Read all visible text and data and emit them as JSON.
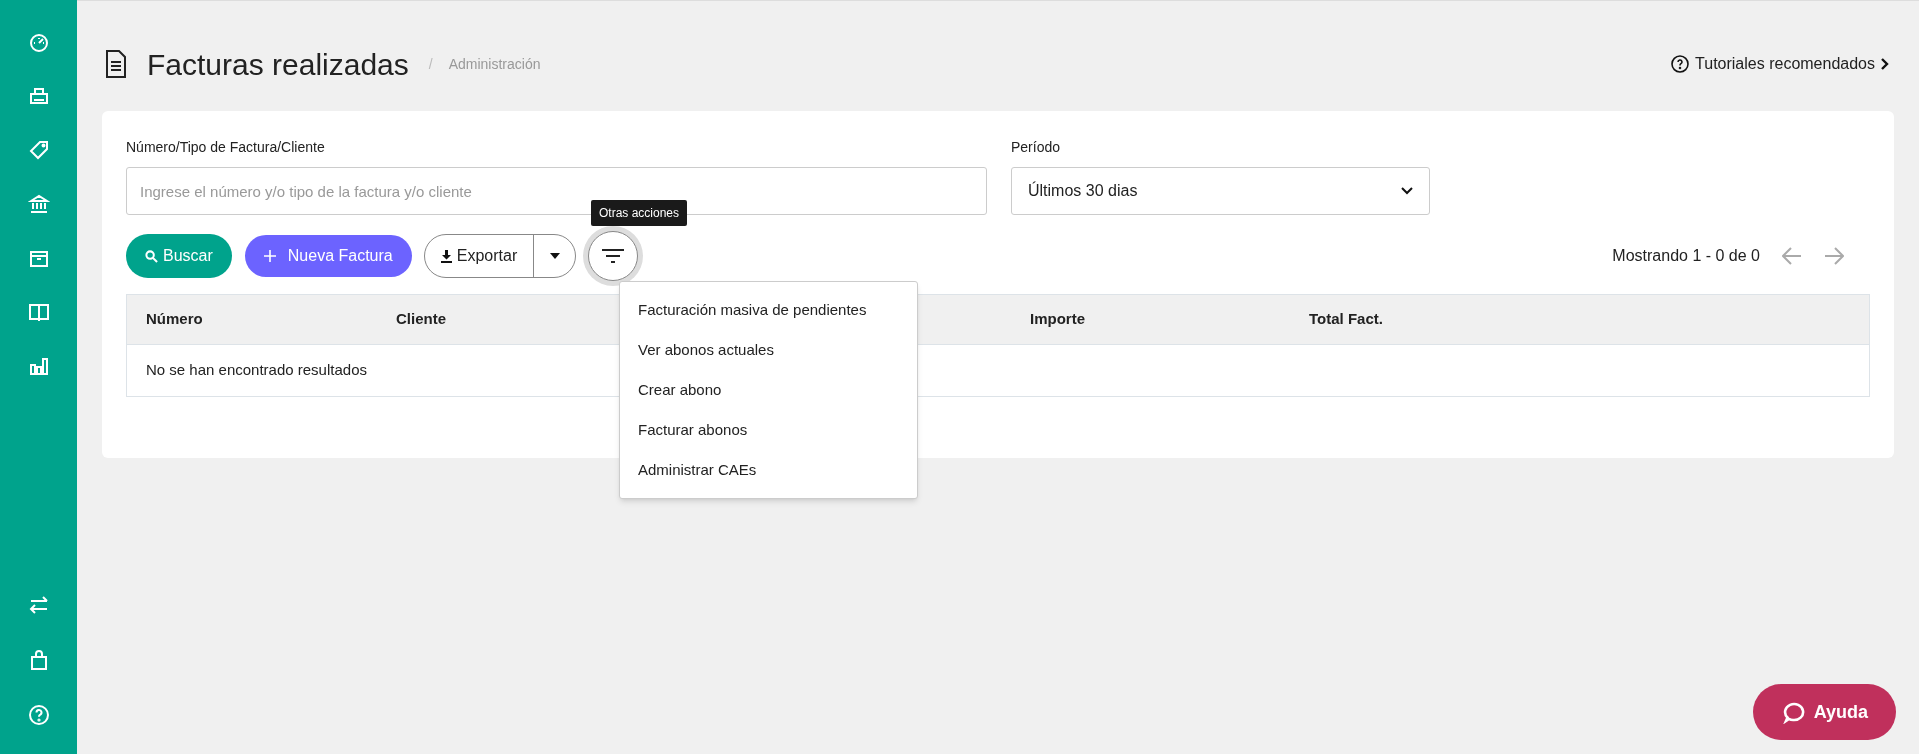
{
  "header": {
    "title": "Facturas realizadas",
    "separator": "/",
    "breadcrumb": "Administración",
    "tutorials_link": "Tutoriales recomendados"
  },
  "filters": {
    "search_label": "Número/Tipo de Factura/Cliente",
    "search_placeholder": "Ingrese el número y/o tipo de la factura y/o cliente",
    "period_label": "Período",
    "period_value": "Últimos 30 dias"
  },
  "actions": {
    "search_button": "Buscar",
    "new_button": "Nueva Factura",
    "export_button": "Exportar",
    "tooltip": "Otras acciones"
  },
  "pagination": {
    "text": "Mostrando 1 - 0 de 0"
  },
  "table": {
    "columns": [
      "Número",
      "Cliente",
      "Importe",
      "Total Fact."
    ],
    "empty_message": "No se han encontrado resultados"
  },
  "menu": {
    "items": [
      "Facturación masiva de pendientes",
      "Ver abonos actuales",
      "Crear abono",
      "Facturar abonos",
      "Administrar CAEs"
    ]
  },
  "help_button": "Ayuda"
}
